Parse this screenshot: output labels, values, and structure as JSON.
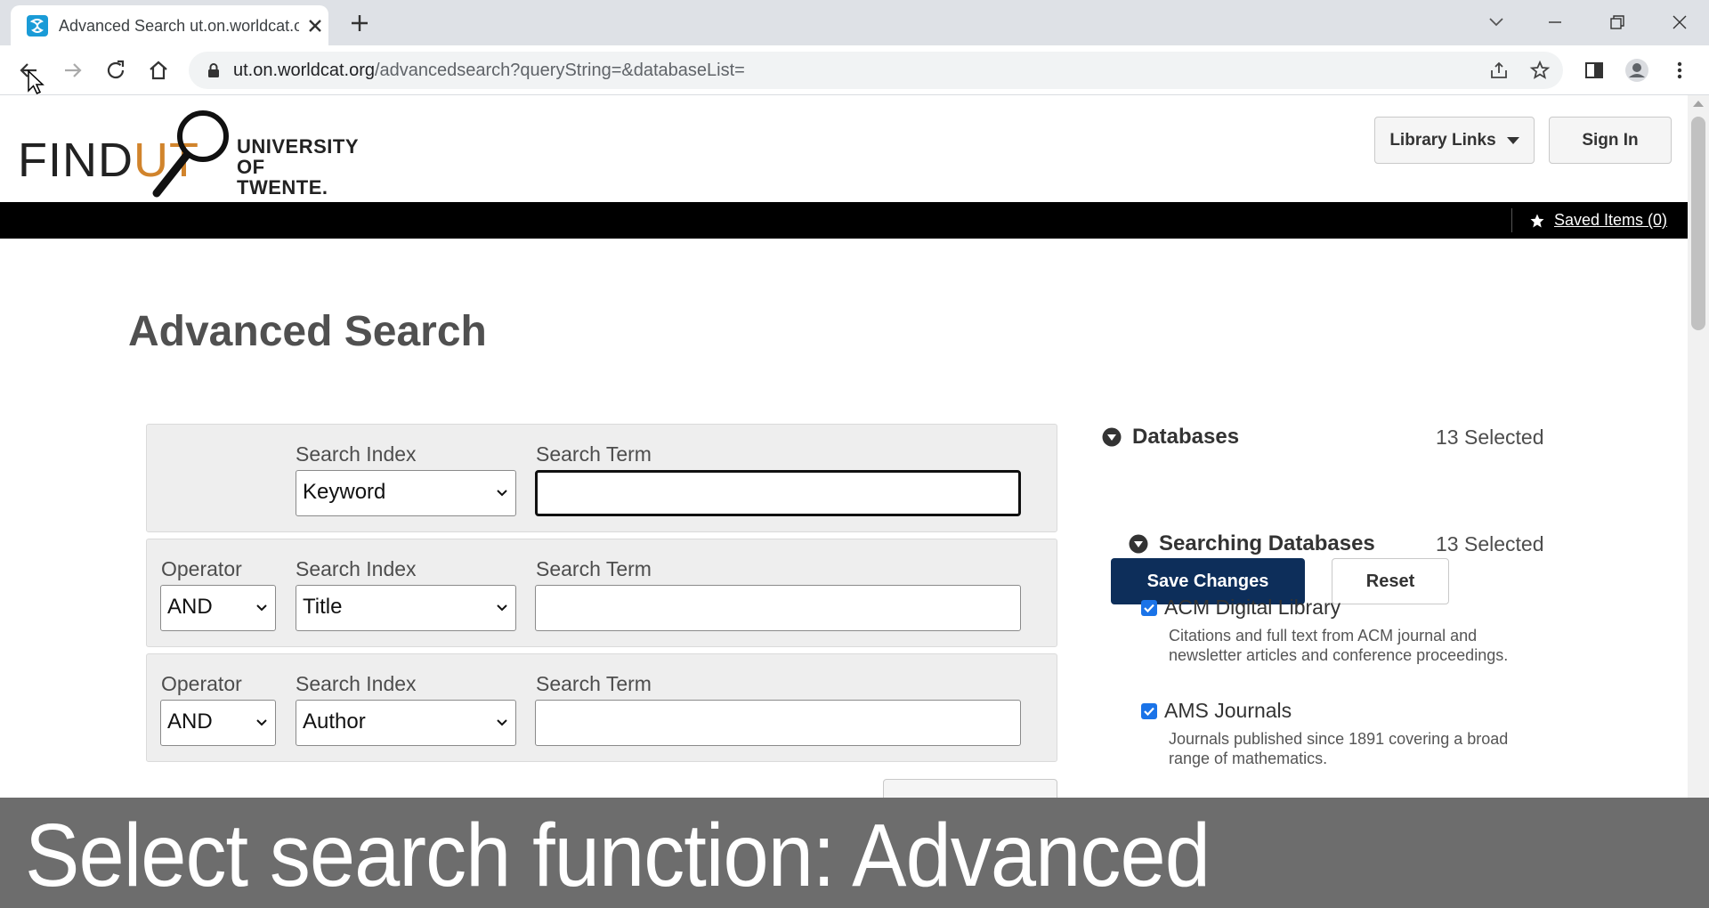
{
  "browser": {
    "tab_title": "Advanced Search ut.on.worldcat.org",
    "url_host": "ut.on.worldcat.org",
    "url_path": "/advancedsearch?queryString=&databaseList="
  },
  "header": {
    "logo_find": "FIND",
    "logo_ut": "UT",
    "logo_uni_line1": "UNIVERSITY",
    "logo_uni_line2": "OF TWENTE.",
    "library_links": "Library Links",
    "sign_in": "Sign In",
    "saved_items": "Saved Items (0)"
  },
  "page_title": "Advanced Search",
  "search_rows": [
    {
      "operator_label": "",
      "operator": "",
      "index_label": "Search Index",
      "index": "Keyword",
      "term_label": "Search Term",
      "term": ""
    },
    {
      "operator_label": "Operator",
      "operator": "AND",
      "index_label": "Search Index",
      "index": "Title",
      "term_label": "Search Term",
      "term": ""
    },
    {
      "operator_label": "Operator",
      "operator": "AND",
      "index_label": "Search Index",
      "index": "Author",
      "term_label": "Search Term",
      "term": ""
    }
  ],
  "databases": {
    "heading": "Databases",
    "selected": "13 Selected",
    "save_changes": "Save Changes",
    "reset": "Reset",
    "searching_heading": "Searching Databases",
    "searching_selected": "13 Selected",
    "items": [
      {
        "name": "ACM Digital Library",
        "description": "Citations and full text from ACM journal and newsletter articles and conference proceedings.",
        "checked": true
      },
      {
        "name": "AMS Journals",
        "description": "Journals published since 1891 covering a broad range of mathematics.",
        "checked": true
      }
    ]
  },
  "caption": "Select search function: Advanced",
  "colors": {
    "accent_orange": "#d1842c",
    "primary_button": "#0d2e5a",
    "black_bar": "#000000",
    "caption_bg": "#6d6d6d"
  }
}
